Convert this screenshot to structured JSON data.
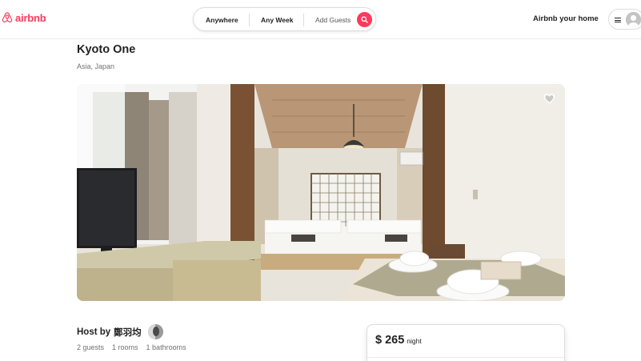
{
  "brand": {
    "name": "airbnb",
    "color": "#ff385c",
    "icon": "airbnb-logo-icon"
  },
  "search": {
    "anywhere": "Anywhere",
    "any_week": "Any Week",
    "add_guests": "Add Guests",
    "icon": "search-icon"
  },
  "header": {
    "host_link": "Airbnb your home",
    "menu_icon": "hamburger-icon",
    "avatar_icon": "user-avatar-icon"
  },
  "listing": {
    "title": "Kyoto One",
    "location": "Asia, Japan",
    "favorite_icon": "heart-icon",
    "host_label": "Host by",
    "host_name": "鄭羽均",
    "stats": [
      "2 guests",
      "1 rooms",
      "1 bathrooms"
    ]
  },
  "booking": {
    "price": "$ 265",
    "unit": "night"
  }
}
